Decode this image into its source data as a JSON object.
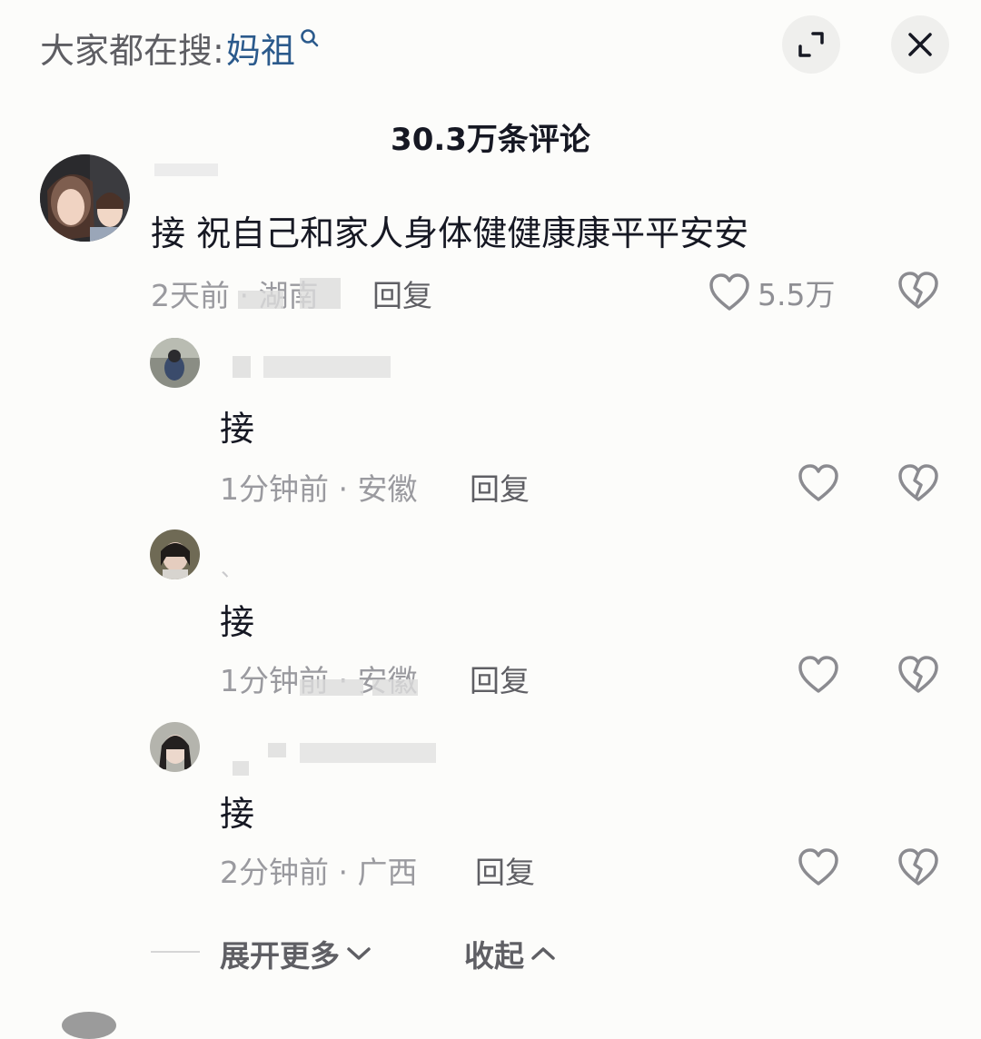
{
  "header": {
    "search_prefix": "大家都在搜:",
    "search_term": "妈祖",
    "expand_icon": "fullscreen-icon",
    "close_icon": "close-icon"
  },
  "title": "30.3万条评论",
  "comments": [
    {
      "text": "接 祝自己和家人身体健健康康平平安安",
      "meta": "2天前 · 湖南",
      "reply_label": "回复",
      "like_count": "5.5万"
    }
  ],
  "replies": [
    {
      "nickname": "、",
      "text": "接",
      "meta": "1分钟前 · 安徽",
      "reply_label": "回复"
    },
    {
      "nickname": "、",
      "text": "接",
      "meta": "1分钟前 · 安徽",
      "reply_label": "回复"
    },
    {
      "nickname": "",
      "text": "接",
      "meta": "2分钟前 · 广西",
      "reply_label": "回复"
    }
  ],
  "footer": {
    "expand_more": "展开更多",
    "collapse": "收起"
  },
  "colors": {
    "background": "#fcfcfa",
    "search_term": "#2b5a8c",
    "text_primary": "#161823",
    "text_meta": "#9a9a9f"
  }
}
